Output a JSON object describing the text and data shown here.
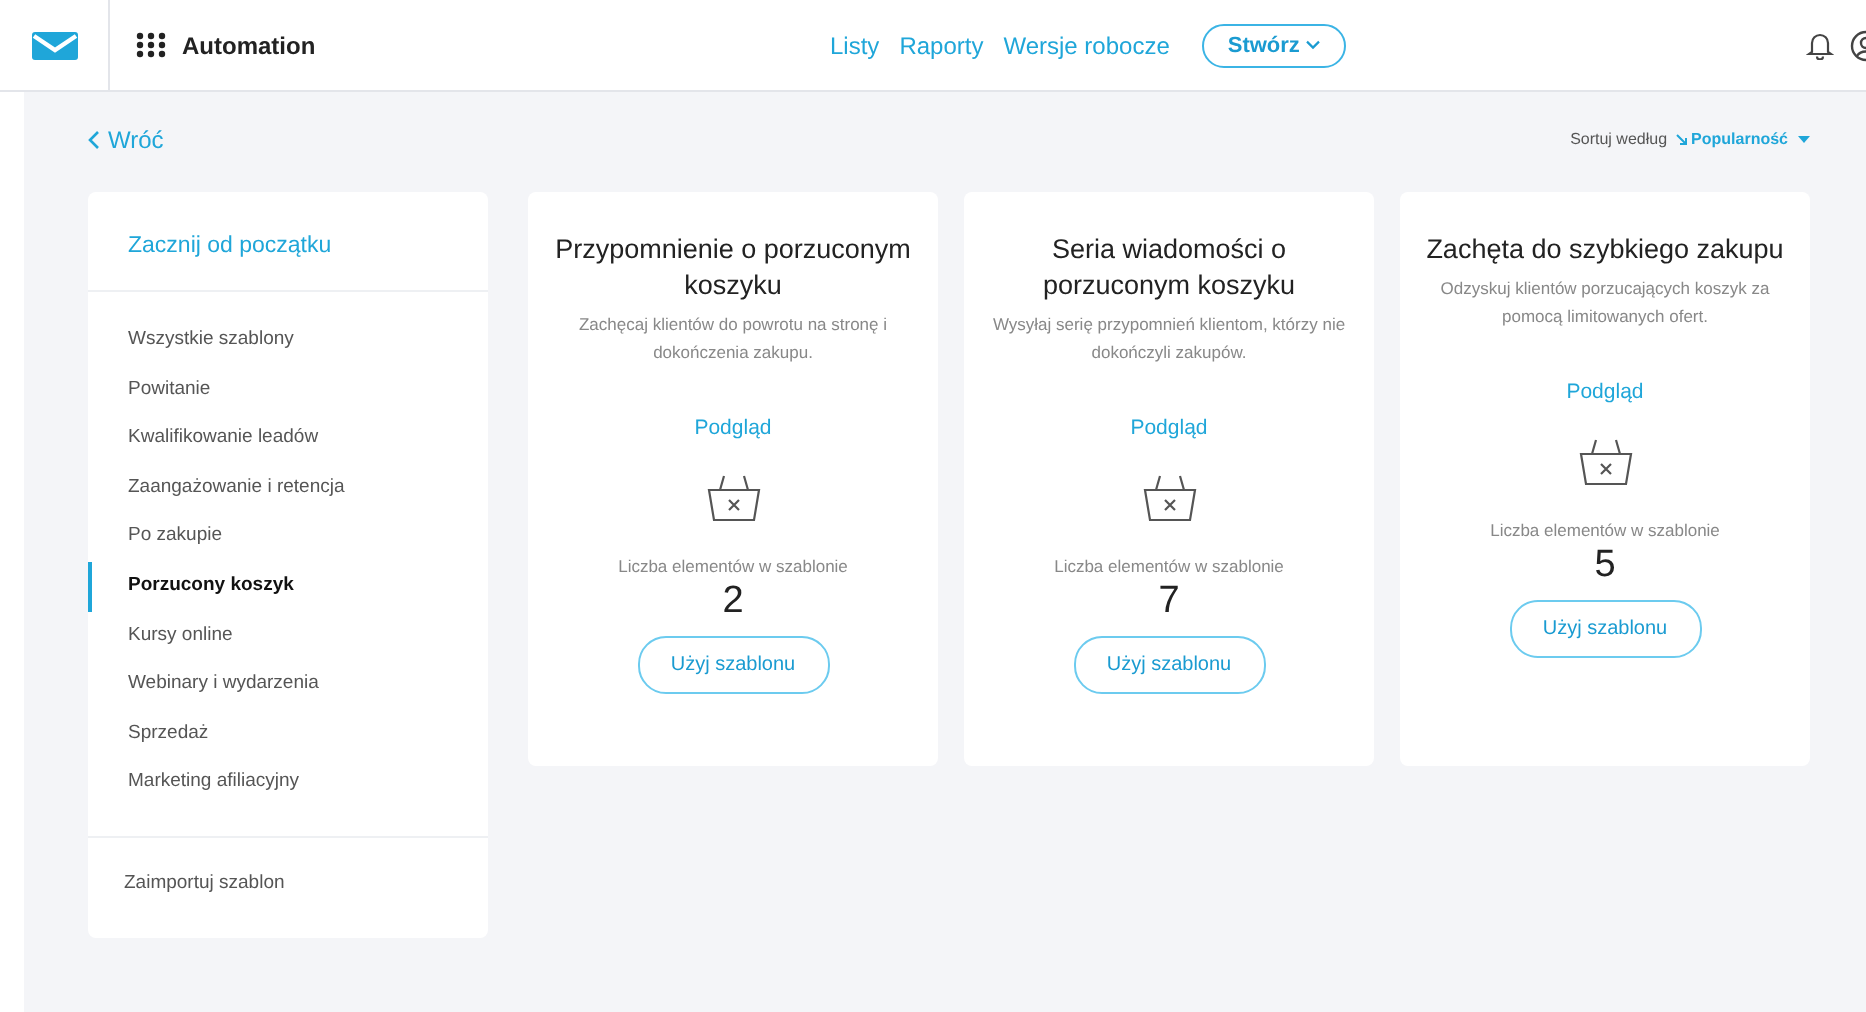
{
  "header": {
    "app_name": "Automation",
    "nav": [
      {
        "label": "Listy"
      },
      {
        "label": "Raporty"
      },
      {
        "label": "Wersje robocze"
      }
    ],
    "create_button": "Stwórz"
  },
  "back_link": "Wróć",
  "sort": {
    "label": "Sortuj według",
    "value": "Popularność"
  },
  "sidebar": {
    "start_link": "Zacznij od początku",
    "items": [
      {
        "label": "Wszystkie szablony",
        "selected": false
      },
      {
        "label": "Powitanie",
        "selected": false
      },
      {
        "label": "Kwalifikowanie leadów",
        "selected": false
      },
      {
        "label": "Zaangażowanie i retencja",
        "selected": false
      },
      {
        "label": "Po zakupie",
        "selected": false
      },
      {
        "label": "Porzucony koszyk",
        "selected": true
      },
      {
        "label": "Kursy online",
        "selected": false
      },
      {
        "label": "Webinary i wydarzenia",
        "selected": false
      },
      {
        "label": "Sprzedaż",
        "selected": false
      },
      {
        "label": "Marketing afiliacyjny",
        "selected": false
      }
    ],
    "import_link": "Zaimportuj szablon"
  },
  "templates": [
    {
      "title": "Przypomnienie o porzuconym koszyku",
      "description": "Zachęcaj klientów do powrotu na stronę i dokończenia zakupu.",
      "preview": "Podgląd",
      "count_label": "Liczba elementów w szablonie",
      "count": "2",
      "button": "Użyj szablonu"
    },
    {
      "title": "Seria wiadomości o porzuconym koszyku",
      "description": "Wysyłaj serię przypomnień klientom, którzy nie dokończyli zakupów.",
      "preview": "Podgląd",
      "count_label": "Liczba elementów w szablonie",
      "count": "7",
      "button": "Użyj szablonu"
    },
    {
      "title": "Zachęta do szybkiego zakupu",
      "description": "Odzyskuj klientów porzucających koszyk za pomocą limitowanych ofert.",
      "preview": "Podgląd",
      "count_label": "Liczba elementów w szablonie",
      "count": "5",
      "button": "Użyj szablonu"
    }
  ]
}
